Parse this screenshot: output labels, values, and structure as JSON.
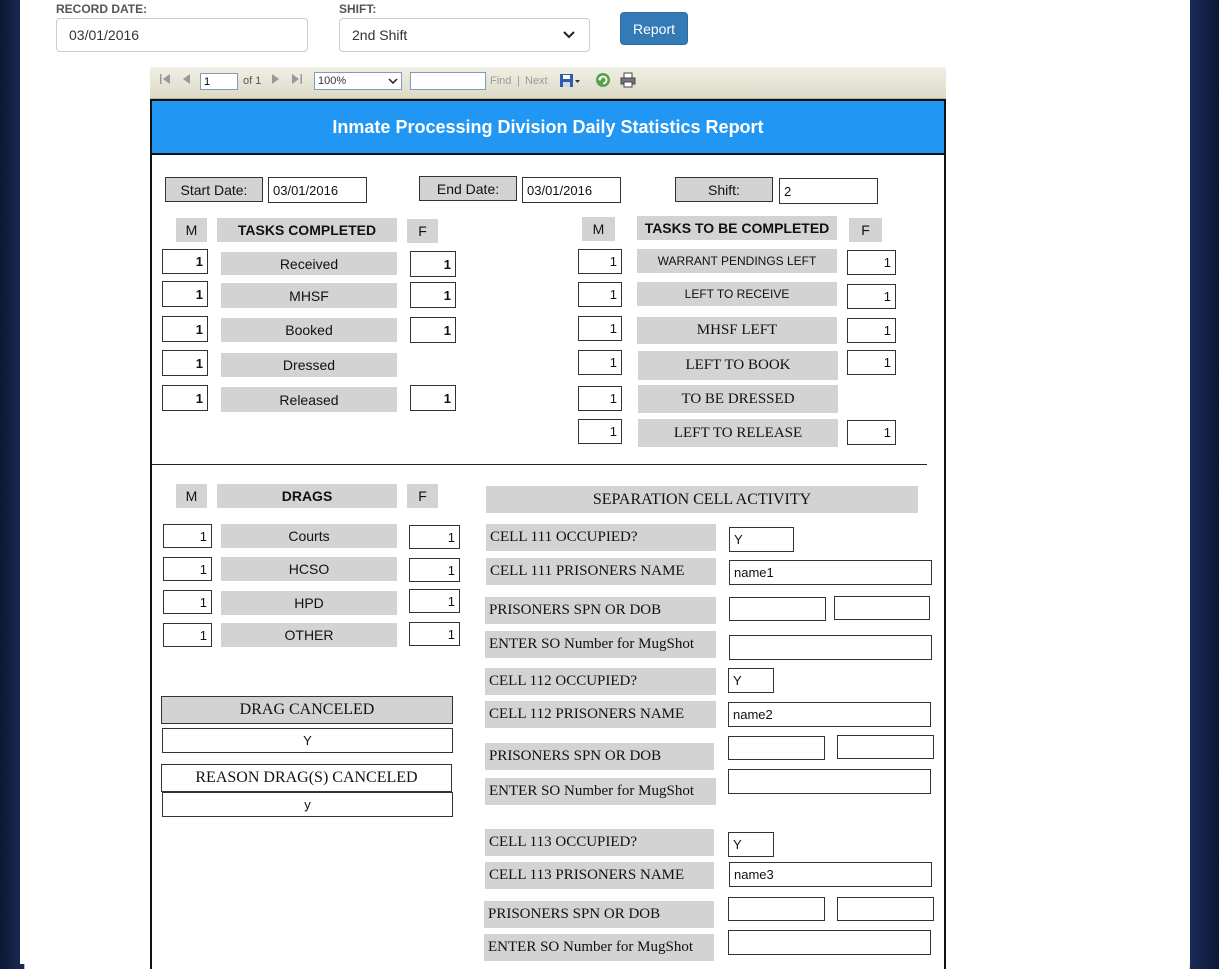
{
  "top": {
    "record_date_label": "RECORD DATE:",
    "record_date_value": "03/01/2016",
    "shift_label": "SHIFT:",
    "shift_value": "2nd Shift",
    "report_button": "Report"
  },
  "toolbar": {
    "page_value": "1",
    "page_of": "of 1",
    "zoom": "100%",
    "find_value": "",
    "find_label": "Find",
    "separator": "|",
    "next_label": "Next"
  },
  "report": {
    "title": "Inmate Processing Division Daily Statistics Report",
    "start_date_label": "Start Date:",
    "start_date_value": "03/01/2016",
    "end_date_label": "End Date:",
    "end_date_value": "03/01/2016",
    "shift_label": "Shift:",
    "shift_value": "2",
    "col_m": "M",
    "col_f": "F",
    "tasks_completed_header": "TASKS COMPLETED",
    "tasks_completed": [
      {
        "label": "Received",
        "m": "1",
        "f": "1"
      },
      {
        "label": "MHSF",
        "m": "1",
        "f": "1"
      },
      {
        "label": "Booked",
        "m": "1",
        "f": "1"
      },
      {
        "label": "Dressed",
        "m": "1",
        "f": ""
      },
      {
        "label": "Released",
        "m": "1",
        "f": "1"
      }
    ],
    "tasks_to_be_header": "TASKS TO BE COMPLETED",
    "tasks_to_be": [
      {
        "label": "WARRANT PENDINGS LEFT",
        "m": "1",
        "f": "1"
      },
      {
        "label": "LEFT TO RECEIVE",
        "m": "1",
        "f": "1"
      },
      {
        "label": "MHSF LEFT",
        "m": "1",
        "f": "1"
      },
      {
        "label": "LEFT TO BOOK",
        "m": "1",
        "f": "1"
      },
      {
        "label": "TO BE DRESSED",
        "m": "1",
        "f": ""
      },
      {
        "label": "LEFT TO RELEASE",
        "m": "1",
        "f": "1"
      }
    ],
    "drags_header": "DRAGS",
    "drags": [
      {
        "label": "Courts",
        "m": "1",
        "f": "1"
      },
      {
        "label": "HCSO",
        "m": "1",
        "f": "1"
      },
      {
        "label": "HPD",
        "m": "1",
        "f": "1"
      },
      {
        "label": "OTHER",
        "m": "1",
        "f": "1"
      }
    ],
    "drag_canceled_label": "DRAG CANCELED",
    "drag_canceled_value": "Y",
    "reason_label": "REASON DRAG(S) CANCELED",
    "reason_value": "y",
    "separation_header": "SEPARATION CELL ACTIVITY",
    "cells": [
      {
        "occupied_label": "CELL 111 OCCUPIED?",
        "occupied": "Y",
        "name_label": "CELL 111 PRISONERS NAME",
        "name": "name1",
        "spn_label": "PRISONERS SPN OR DOB",
        "spn": "",
        "dob": "",
        "so_label": "ENTER SO Number for MugShot",
        "so": ""
      },
      {
        "occupied_label": "CELL 112 OCCUPIED?",
        "occupied": "Y",
        "name_label": "CELL 112 PRISONERS NAME",
        "name": "name2",
        "spn_label": "PRISONERS SPN OR DOB",
        "spn": "",
        "dob": "",
        "so_label": "ENTER SO Number for MugShot",
        "so": ""
      },
      {
        "occupied_label": "CELL 113 OCCUPIED?",
        "occupied": "Y",
        "name_label": "CELL 113 PRISONERS NAME",
        "name": "name3",
        "spn_label": "PRISONERS SPN OR DOB",
        "spn": "",
        "dob": "",
        "so_label": "ENTER SO Number for MugShot",
        "so": ""
      }
    ]
  },
  "colors": {
    "header_blue": "#2196f3",
    "button_blue": "#337ab7",
    "label_gray": "#d3d3d3"
  }
}
